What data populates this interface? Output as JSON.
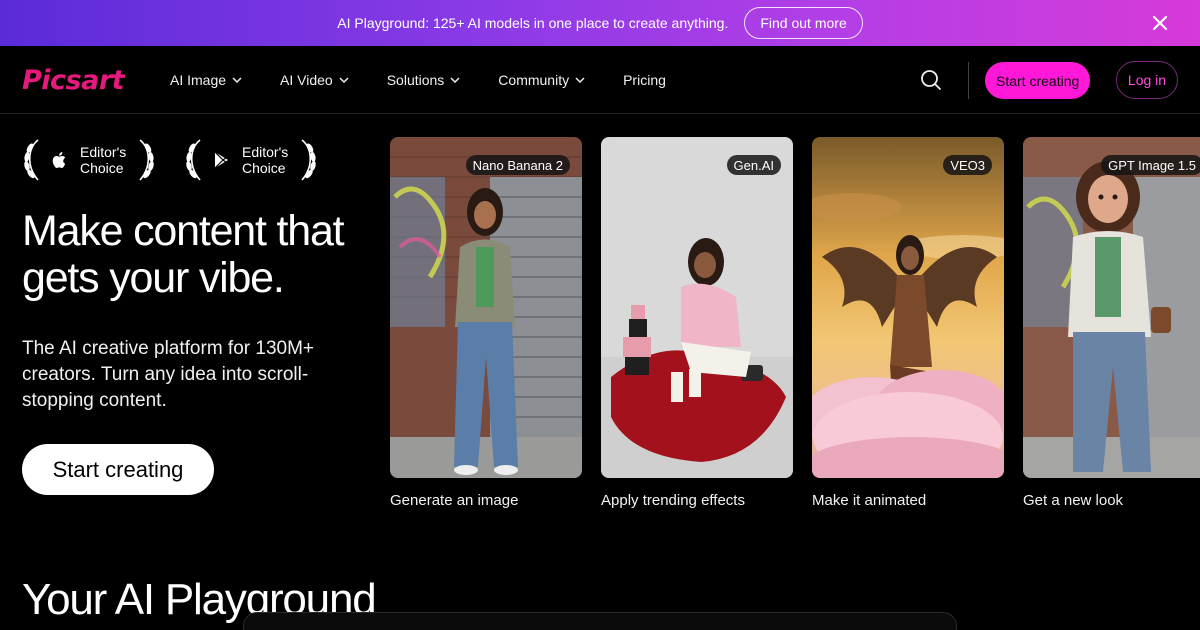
{
  "promo": {
    "text": "AI Playground: 125+ AI models in one place to create anything.",
    "button": "Find out more",
    "close_icon": "close-icon"
  },
  "nav": {
    "logo": "Picsart",
    "items": [
      {
        "label": "AI Image",
        "has_dropdown": true
      },
      {
        "label": "AI Video",
        "has_dropdown": true
      },
      {
        "label": "Solutions",
        "has_dropdown": true
      },
      {
        "label": "Community",
        "has_dropdown": true
      },
      {
        "label": "Pricing",
        "has_dropdown": false
      }
    ],
    "search_icon": "search-icon",
    "start_creating": "Start creating",
    "login": "Log in",
    "accent": "#ff18d8"
  },
  "hero": {
    "awards": [
      {
        "platform_icon": "apple-icon",
        "text": "Editor's Choice"
      },
      {
        "platform_icon": "google-play-icon",
        "text": "Editor's Choice"
      }
    ],
    "title": "Make content that gets your vibe.",
    "subtitle": "The AI creative platform for 130M+ creators. Turn any idea into scroll-stopping content.",
    "cta": "Start creating"
  },
  "cards": [
    {
      "badge": "Nano Banana 2",
      "caption": "Generate an image"
    },
    {
      "badge": "Gen.AI",
      "caption": "Apply trending effects"
    },
    {
      "badge": "VEO3",
      "caption": "Make it animated"
    },
    {
      "badge": "GPT Image 1.5",
      "caption": "Get a new look"
    }
  ],
  "playground": {
    "title": "Your AI Playground"
  }
}
